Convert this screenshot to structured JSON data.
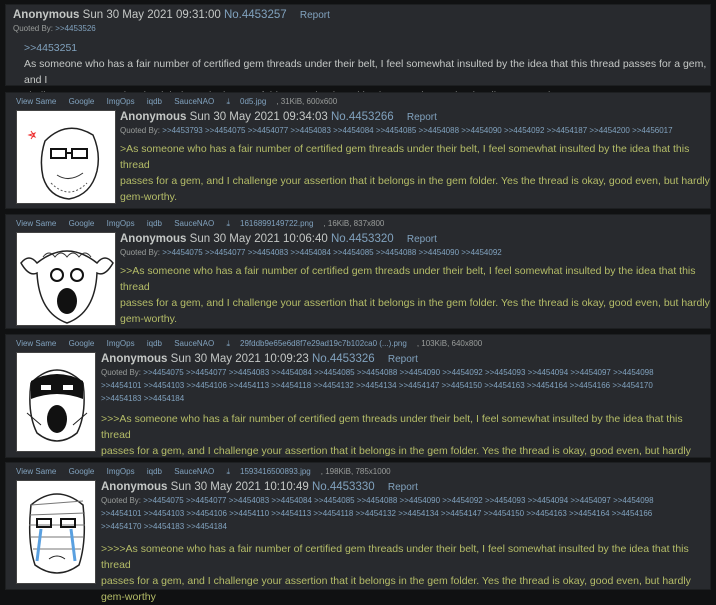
{
  "op": {
    "name": "Anonymous",
    "date": "Sun 30 May 2021 09:31:00",
    "no": "No.4453257",
    "report": "Report",
    "quoted_label": "Quoted By:",
    "quoted_by": ">>4453526",
    "quotelink": ">>4453251",
    "text_line1": "As someone who has a fair number of certified gem threads under their belt, I feel somewhat insulted by the idea that this thread passes for a gem, and I",
    "text_line2": "challenge your assertion that it belongs in the gem folder. Yes the thread is okay, good even, but hardly gem-worthy."
  },
  "tools": [
    "View Same",
    "Google",
    "ImgOps",
    "iqdb",
    "SauceNAO"
  ],
  "posts": [
    {
      "file_name": "0d5.jpg",
      "file_meta": ", 31KiB, 600x600",
      "name": "Anonymous",
      "date": "Sun 30 May 2021 09:34:03",
      "no": "No.4453266",
      "report": "Report",
      "quoted_label": "Quoted By:",
      "quoted_lines": [
        ">>4453793 >>4454075 >>4454077 >>4454083 >>4454084 >>4454085 >>4454088 >>4454090 >>4454092 >>4454187 >>4454200 >>4456017"
      ],
      "text_lines": [
        ">As someone who has a fair number of certified gem threads under their belt, I feel somewhat insulted by the idea that this thread",
        "passes for a gem, and I challenge your assertion that it belongs in the gem folder. Yes the thread is okay, good even, but hardly",
        "gem-worthy."
      ],
      "thumb_icon": "soyjak-glasses-thumbnail"
    },
    {
      "file_name": "1616899149722.png",
      "file_meta": ", 16KiB, 837x800",
      "name": "Anonymous",
      "date": "Sun 30 May 2021 10:06:40",
      "no": "No.4453320",
      "report": "Report",
      "quoted_label": "Quoted By:",
      "quoted_lines": [
        ">>4454075 >>4454077 >>4454083 >>4454084 >>4454085 >>4454088 >>4454090 >>4454092"
      ],
      "text_lines": [
        ">>As someone who has a fair number of certified gem threads under their belt, I feel somewhat insulted by the idea that this thread",
        "passes for a gem, and I challenge your assertion that it belongs in the gem folder. Yes the thread is okay, good even, but hardly",
        "gem-worthy."
      ],
      "thumb_icon": "sheep-soyjak-thumbnail"
    },
    {
      "file_name": "29fddb9e65e6d8f7e29ad19c7b102ca0 (...).png",
      "file_meta": ", 103KiB, 640x800",
      "name": "Anonymous",
      "date": "Sun 30 May 2021 10:09:23",
      "no": "No.4453326",
      "report": "Report",
      "quoted_label": "Quoted By:",
      "quoted_lines": [
        ">>4454075 >>4454077 >>4454083 >>4454084 >>4454085 >>4454088 >>4454090 >>4454092 >>4454093 >>4454094 >>4454097 >>4454098",
        ">>4454101 >>4454103 >>4454106 >>4454113 >>4454118 >>4454132 >>4454134 >>4454147 >>4454150 >>4454163 >>4454164 >>4454166 >>4454170",
        ">>4454183 >>4454184"
      ],
      "text_lines": [
        ">>>As someone who has a fair number of certified gem threads under their belt, I feel somewhat insulted by the idea that this thread",
        "passes for a gem, and I challenge your assertion that it belongs in the gem folder. Yes the thread is okay, good even, but hardly gem-",
        "worthy"
      ],
      "thumb_icon": "masked-soyjak-thumbnail"
    },
    {
      "file_name": "1593416500893.jpg",
      "file_meta": ", 198KiB, 785x1000",
      "name": "Anonymous",
      "date": "Sun 30 May 2021 10:10:49",
      "no": "No.4453330",
      "report": "Report",
      "quoted_label": "Quoted By:",
      "quoted_lines": [
        ">>4454075 >>4454077 >>4454083 >>4454084 >>4454085 >>4454088 >>4454090 >>4454092 >>4454093 >>4454094 >>4454097 >>4454098",
        ">>4454101 >>4454103 >>4454106 >>4454110 >>4454113 >>4454118 >>4454132 >>4454134 >>4454147 >>4454150 >>4454163 >>4454164 >>4454166",
        ">>4454170 >>4454183 >>4454184"
      ],
      "text_lines": [
        ">>>>As someone who has a fair number of certified gem threads under their belt, I feel somewhat insulted by the idea that this thread",
        "passes for a gem, and I challenge your assertion that it belongs in the gem folder. Yes the thread is okay, good even, but hardly",
        "gem-worthy"
      ],
      "thumb_icon": "bandaged-crying-soyjak-thumbnail"
    }
  ]
}
